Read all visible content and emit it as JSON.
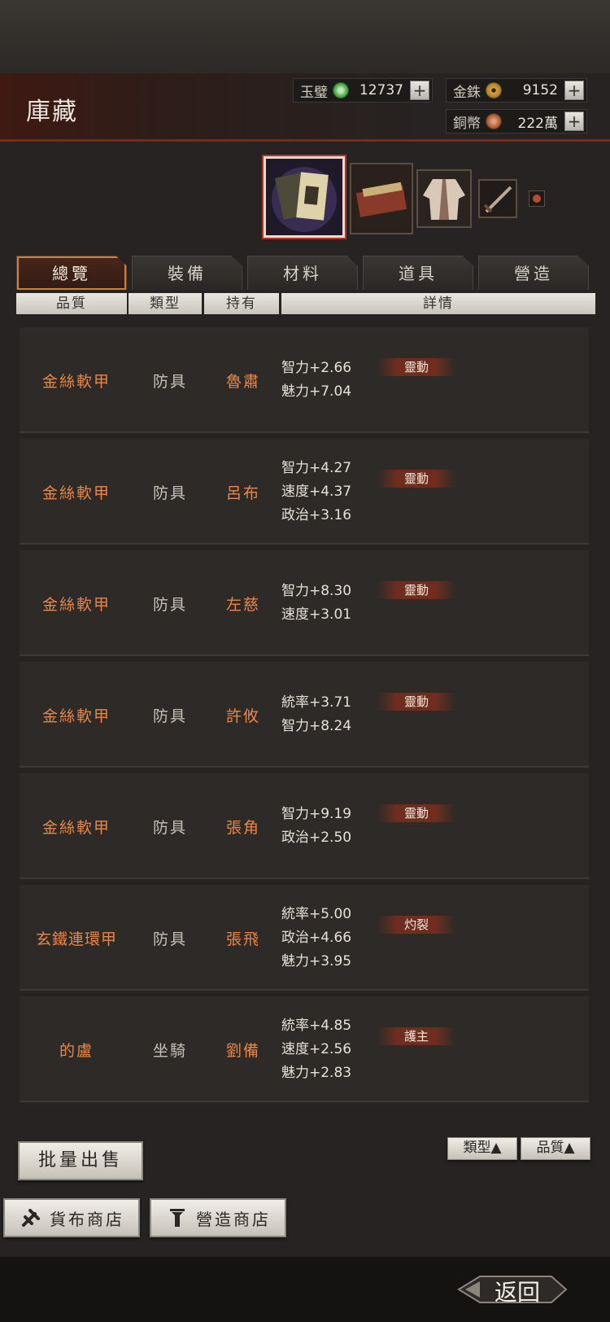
{
  "header": {
    "title": "庫藏"
  },
  "currencies": [
    {
      "label": "玉璧",
      "value": "12737",
      "color": "#4aa84a"
    },
    {
      "label": "金銖",
      "value": "9152",
      "color": "#d8a43a"
    },
    {
      "label": "銅幣",
      "value": "222萬",
      "color": "#b2643c"
    }
  ],
  "tabs": [
    "總覽",
    "裝備",
    "材料",
    "道具",
    "營造"
  ],
  "columns": [
    "品質",
    "類型",
    "持有",
    "詳情"
  ],
  "items": [
    {
      "name": "金絲軟甲",
      "type": "防具",
      "holder": "魯肅",
      "stats": [
        "智力+2.66",
        "魅力+7.04"
      ],
      "tag": "靈動"
    },
    {
      "name": "金絲軟甲",
      "type": "防具",
      "holder": "呂布",
      "stats": [
        "智力+4.27",
        "速度+4.37",
        "政治+3.16"
      ],
      "tag": "靈動"
    },
    {
      "name": "金絲軟甲",
      "type": "防具",
      "holder": "左慈",
      "stats": [
        "智力+8.30",
        "速度+3.01"
      ],
      "tag": "靈動"
    },
    {
      "name": "金絲軟甲",
      "type": "防具",
      "holder": "許攸",
      "stats": [
        "統率+3.71",
        "智力+8.24"
      ],
      "tag": "靈動"
    },
    {
      "name": "金絲軟甲",
      "type": "防具",
      "holder": "張角",
      "stats": [
        "智力+9.19",
        "政治+2.50"
      ],
      "tag": "靈動"
    },
    {
      "name": "玄鐵連環甲",
      "type": "防具",
      "holder": "張飛",
      "stats": [
        "統率+5.00",
        "政治+4.66",
        "魅力+3.95"
      ],
      "tag": "灼裂"
    },
    {
      "name": "的盧",
      "type": "坐騎",
      "holder": "劉備",
      "stats": [
        "統率+4.85",
        "速度+2.56",
        "魅力+2.83"
      ],
      "tag": "護主"
    }
  ],
  "sort": {
    "type_label": "類型▲",
    "quality_label": "品質▲"
  },
  "buttons": {
    "bulk_sell": "批量出售",
    "currency_shop": "貨布商店",
    "build_shop": "營造商店",
    "back": "返回"
  }
}
